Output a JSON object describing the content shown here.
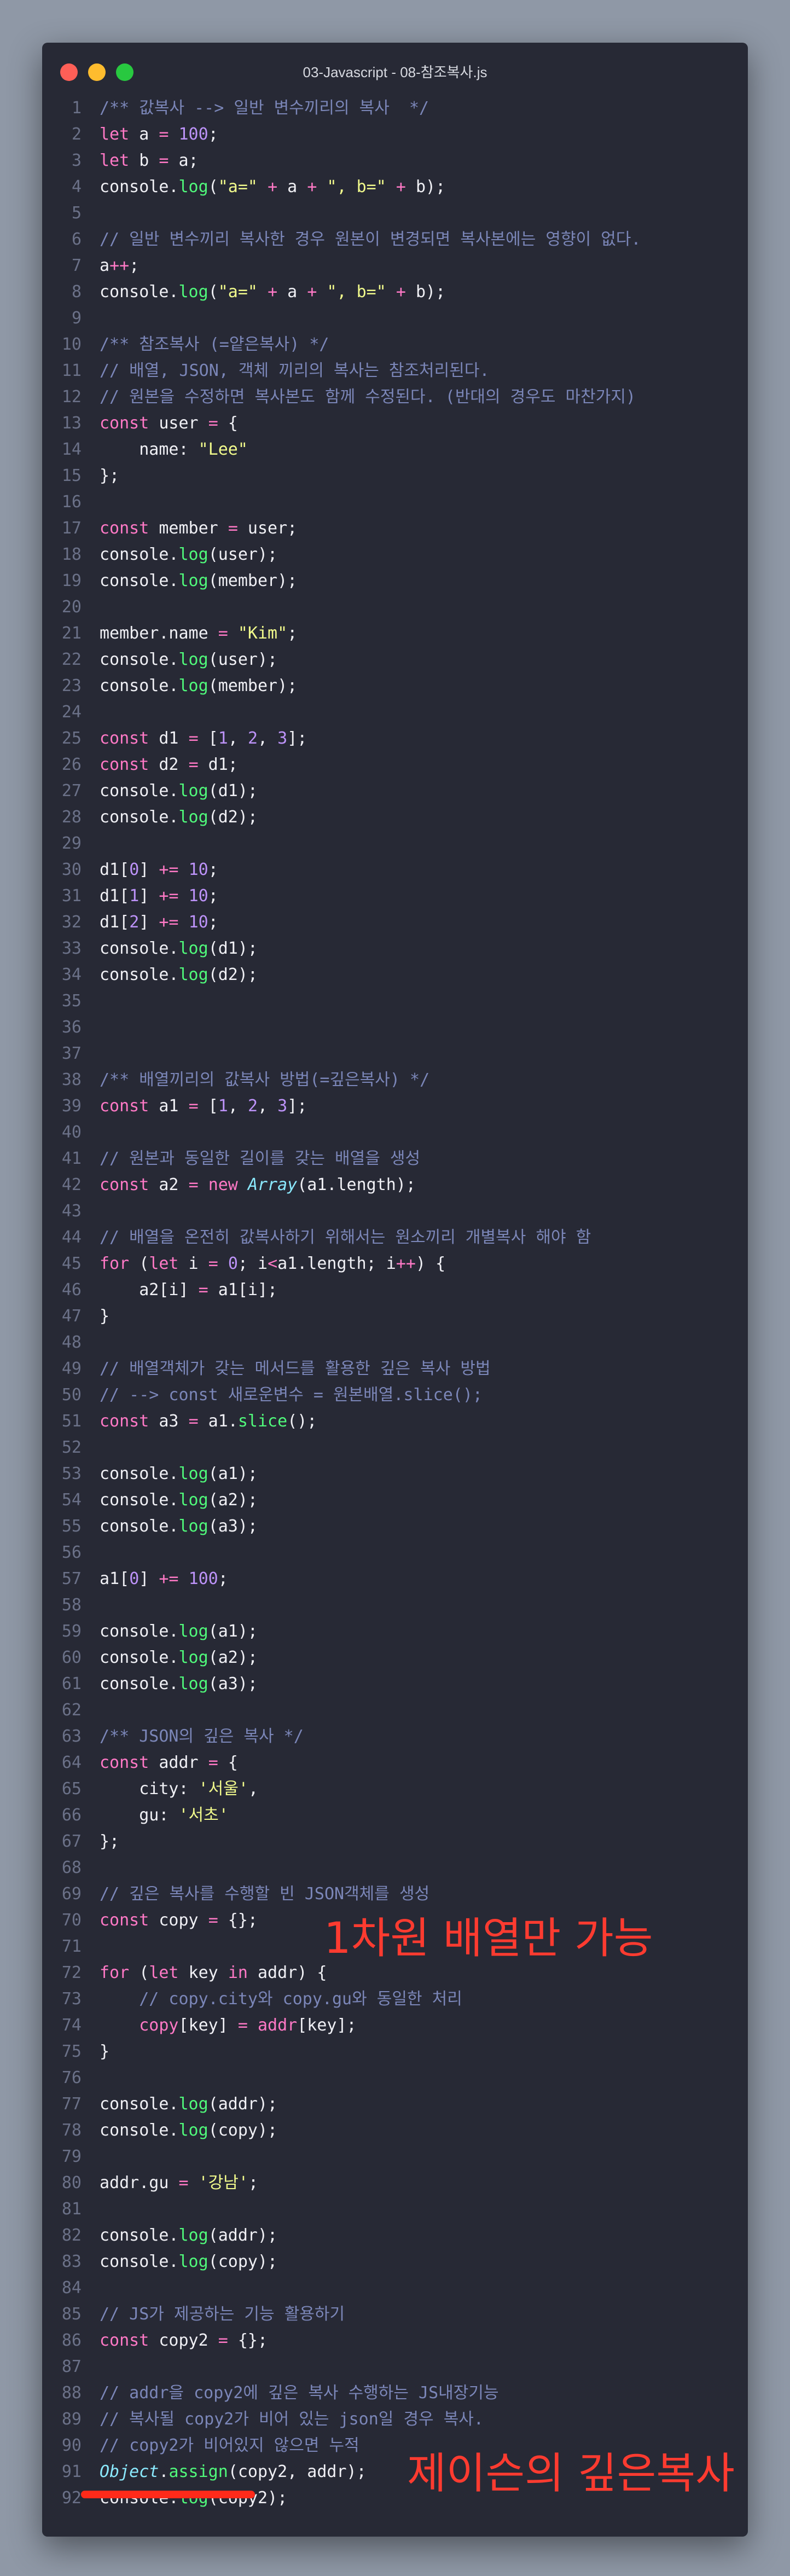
{
  "window": {
    "title": "03-Javascript - 08-참조복사.js"
  },
  "lines": [
    [
      [
        "cm",
        "/** 값복사 --> 일반 변수끼리의 복사  */"
      ]
    ],
    [
      [
        "kw",
        "let"
      ],
      [
        "pl",
        " a "
      ],
      [
        "op",
        "="
      ],
      [
        "pl",
        " "
      ],
      [
        "num",
        "100"
      ],
      [
        "pl",
        ";"
      ]
    ],
    [
      [
        "kw",
        "let"
      ],
      [
        "pl",
        " b "
      ],
      [
        "op",
        "="
      ],
      [
        "pl",
        " a;"
      ]
    ],
    [
      [
        "pl",
        "console."
      ],
      [
        "fn",
        "log"
      ],
      [
        "pl",
        "("
      ],
      [
        "str",
        "\"a=\""
      ],
      [
        "pl",
        " "
      ],
      [
        "op",
        "+"
      ],
      [
        "pl",
        " a "
      ],
      [
        "op",
        "+"
      ],
      [
        "pl",
        " "
      ],
      [
        "str",
        "\", b=\""
      ],
      [
        "pl",
        " "
      ],
      [
        "op",
        "+"
      ],
      [
        "pl",
        " b);"
      ]
    ],
    [],
    [
      [
        "cm",
        "// 일반 변수끼리 복사한 경우 원본이 변경되면 복사본에는 영향이 없다."
      ]
    ],
    [
      [
        "pl",
        "a"
      ],
      [
        "op",
        "++"
      ],
      [
        "pl",
        ";"
      ]
    ],
    [
      [
        "pl",
        "console."
      ],
      [
        "fn",
        "log"
      ],
      [
        "pl",
        "("
      ],
      [
        "str",
        "\"a=\""
      ],
      [
        "pl",
        " "
      ],
      [
        "op",
        "+"
      ],
      [
        "pl",
        " a "
      ],
      [
        "op",
        "+"
      ],
      [
        "pl",
        " "
      ],
      [
        "str",
        "\", b=\""
      ],
      [
        "pl",
        " "
      ],
      [
        "op",
        "+"
      ],
      [
        "pl",
        " b);"
      ]
    ],
    [],
    [
      [
        "cm",
        "/** 참조복사 (=얕은복사) */"
      ]
    ],
    [
      [
        "cm",
        "// 배열, JSON, 객체 끼리의 복사는 참조처리된다."
      ]
    ],
    [
      [
        "cm",
        "// 원본을 수정하면 복사본도 함께 수정된다. (반대의 경우도 마찬가지)"
      ]
    ],
    [
      [
        "kw",
        "const"
      ],
      [
        "pl",
        " user "
      ],
      [
        "op",
        "="
      ],
      [
        "pl",
        " {"
      ]
    ],
    [
      [
        "pl",
        "    name: "
      ],
      [
        "str",
        "\"Lee\""
      ]
    ],
    [
      [
        "pl",
        "};"
      ]
    ],
    [],
    [
      [
        "kw",
        "const"
      ],
      [
        "pl",
        " member "
      ],
      [
        "op",
        "="
      ],
      [
        "pl",
        " user;"
      ]
    ],
    [
      [
        "pl",
        "console."
      ],
      [
        "fn",
        "log"
      ],
      [
        "pl",
        "(user);"
      ]
    ],
    [
      [
        "pl",
        "console."
      ],
      [
        "fn",
        "log"
      ],
      [
        "pl",
        "(member);"
      ]
    ],
    [],
    [
      [
        "pl",
        "member.name "
      ],
      [
        "op",
        "="
      ],
      [
        "pl",
        " "
      ],
      [
        "str",
        "\"Kim\""
      ],
      [
        "pl",
        ";"
      ]
    ],
    [
      [
        "pl",
        "console."
      ],
      [
        "fn",
        "log"
      ],
      [
        "pl",
        "(user);"
      ]
    ],
    [
      [
        "pl",
        "console."
      ],
      [
        "fn",
        "log"
      ],
      [
        "pl",
        "(member);"
      ]
    ],
    [],
    [
      [
        "kw",
        "const"
      ],
      [
        "pl",
        " d1 "
      ],
      [
        "op",
        "="
      ],
      [
        "pl",
        " ["
      ],
      [
        "num",
        "1"
      ],
      [
        "pl",
        ", "
      ],
      [
        "num",
        "2"
      ],
      [
        "pl",
        ", "
      ],
      [
        "num",
        "3"
      ],
      [
        "pl",
        "];"
      ]
    ],
    [
      [
        "kw",
        "const"
      ],
      [
        "pl",
        " d2 "
      ],
      [
        "op",
        "="
      ],
      [
        "pl",
        " d1;"
      ]
    ],
    [
      [
        "pl",
        "console."
      ],
      [
        "fn",
        "log"
      ],
      [
        "pl",
        "(d1);"
      ]
    ],
    [
      [
        "pl",
        "console."
      ],
      [
        "fn",
        "log"
      ],
      [
        "pl",
        "(d2);"
      ]
    ],
    [],
    [
      [
        "pl",
        "d1["
      ],
      [
        "num",
        "0"
      ],
      [
        "pl",
        "] "
      ],
      [
        "op",
        "+="
      ],
      [
        "pl",
        " "
      ],
      [
        "num",
        "10"
      ],
      [
        "pl",
        ";"
      ]
    ],
    [
      [
        "pl",
        "d1["
      ],
      [
        "num",
        "1"
      ],
      [
        "pl",
        "] "
      ],
      [
        "op",
        "+="
      ],
      [
        "pl",
        " "
      ],
      [
        "num",
        "10"
      ],
      [
        "pl",
        ";"
      ]
    ],
    [
      [
        "pl",
        "d1["
      ],
      [
        "num",
        "2"
      ],
      [
        "pl",
        "] "
      ],
      [
        "op",
        "+="
      ],
      [
        "pl",
        " "
      ],
      [
        "num",
        "10"
      ],
      [
        "pl",
        ";"
      ]
    ],
    [
      [
        "pl",
        "console."
      ],
      [
        "fn",
        "log"
      ],
      [
        "pl",
        "(d1);"
      ]
    ],
    [
      [
        "pl",
        "console."
      ],
      [
        "fn",
        "log"
      ],
      [
        "pl",
        "(d2);"
      ]
    ],
    [],
    [],
    [],
    [
      [
        "cm",
        "/** 배열끼리의 값복사 방법(=깊은복사) */"
      ]
    ],
    [
      [
        "kw",
        "const"
      ],
      [
        "pl",
        " a1 "
      ],
      [
        "op",
        "="
      ],
      [
        "pl",
        " ["
      ],
      [
        "num",
        "1"
      ],
      [
        "pl",
        ", "
      ],
      [
        "num",
        "2"
      ],
      [
        "pl",
        ", "
      ],
      [
        "num",
        "3"
      ],
      [
        "pl",
        "];"
      ]
    ],
    [],
    [
      [
        "cm",
        "// 원본과 동일한 길이를 갖는 배열을 생성"
      ]
    ],
    [
      [
        "kw",
        "const"
      ],
      [
        "pl",
        " a2 "
      ],
      [
        "op",
        "="
      ],
      [
        "pl",
        " "
      ],
      [
        "kw",
        "new"
      ],
      [
        "pl",
        " "
      ],
      [
        "cls",
        "Array"
      ],
      [
        "pl",
        "(a1.length);"
      ]
    ],
    [],
    [
      [
        "cm",
        "// 배열을 온전히 값복사하기 위해서는 원소끼리 개별복사 해야 함"
      ]
    ],
    [
      [
        "kw",
        "for"
      ],
      [
        "pl",
        " ("
      ],
      [
        "kw",
        "let"
      ],
      [
        "pl",
        " i "
      ],
      [
        "op",
        "="
      ],
      [
        "pl",
        " "
      ],
      [
        "num",
        "0"
      ],
      [
        "pl",
        "; i"
      ],
      [
        "op",
        "<"
      ],
      [
        "pl",
        "a1.length; i"
      ],
      [
        "op",
        "++"
      ],
      [
        "pl",
        ") {"
      ]
    ],
    [
      [
        "pl",
        "    a2[i] "
      ],
      [
        "op",
        "="
      ],
      [
        "pl",
        " a1[i];"
      ]
    ],
    [
      [
        "pl",
        "}"
      ]
    ],
    [],
    [
      [
        "cm",
        "// 배열객체가 갖는 메서드를 활용한 깊은 복사 방법"
      ]
    ],
    [
      [
        "cm",
        "// --> const 새로운변수 = 원본배열.slice();"
      ]
    ],
    [
      [
        "kw",
        "const"
      ],
      [
        "pl",
        " a3 "
      ],
      [
        "op",
        "="
      ],
      [
        "pl",
        " a1."
      ],
      [
        "fn",
        "slice"
      ],
      [
        "pl",
        "();"
      ]
    ],
    [],
    [
      [
        "pl",
        "console."
      ],
      [
        "fn",
        "log"
      ],
      [
        "pl",
        "(a1);"
      ]
    ],
    [
      [
        "pl",
        "console."
      ],
      [
        "fn",
        "log"
      ],
      [
        "pl",
        "(a2);"
      ]
    ],
    [
      [
        "pl",
        "console."
      ],
      [
        "fn",
        "log"
      ],
      [
        "pl",
        "(a3);"
      ]
    ],
    [],
    [
      [
        "pl",
        "a1["
      ],
      [
        "num",
        "0"
      ],
      [
        "pl",
        "] "
      ],
      [
        "op",
        "+="
      ],
      [
        "pl",
        " "
      ],
      [
        "num",
        "100"
      ],
      [
        "pl",
        ";"
      ]
    ],
    [],
    [
      [
        "pl",
        "console."
      ],
      [
        "fn",
        "log"
      ],
      [
        "pl",
        "(a1);"
      ]
    ],
    [
      [
        "pl",
        "console."
      ],
      [
        "fn",
        "log"
      ],
      [
        "pl",
        "(a2);"
      ]
    ],
    [
      [
        "pl",
        "console."
      ],
      [
        "fn",
        "log"
      ],
      [
        "pl",
        "(a3);"
      ]
    ],
    [],
    [
      [
        "cm",
        "/** JSON의 깊은 복사 */"
      ]
    ],
    [
      [
        "kw",
        "const"
      ],
      [
        "pl",
        " addr "
      ],
      [
        "op",
        "="
      ],
      [
        "pl",
        " {"
      ]
    ],
    [
      [
        "pl",
        "    city: "
      ],
      [
        "str",
        "'서울'"
      ],
      [
        "pl",
        ","
      ]
    ],
    [
      [
        "pl",
        "    gu: "
      ],
      [
        "str",
        "'서초'"
      ]
    ],
    [
      [
        "pl",
        "};"
      ]
    ],
    [],
    [
      [
        "cm",
        "// 깊은 복사를 수행할 빈 JSON객체를 생성"
      ]
    ],
    [
      [
        "kw",
        "const"
      ],
      [
        "pl",
        " copy "
      ],
      [
        "op",
        "="
      ],
      [
        "pl",
        " {};"
      ]
    ],
    [],
    [
      [
        "kw",
        "for"
      ],
      [
        "pl",
        " ("
      ],
      [
        "kw",
        "let"
      ],
      [
        "pl",
        " key "
      ],
      [
        "kw",
        "in"
      ],
      [
        "pl",
        " addr) {"
      ]
    ],
    [
      [
        "pl",
        "    "
      ],
      [
        "cm",
        "// copy.city와 copy.gu와 동일한 처리"
      ]
    ],
    [
      [
        "pl",
        "    "
      ],
      [
        "prop",
        "copy"
      ],
      [
        "pl",
        "[key] "
      ],
      [
        "op",
        "="
      ],
      [
        "pl",
        " "
      ],
      [
        "prop",
        "addr"
      ],
      [
        "pl",
        "[key];"
      ]
    ],
    [
      [
        "pl",
        "}"
      ]
    ],
    [],
    [
      [
        "pl",
        "console."
      ],
      [
        "fn",
        "log"
      ],
      [
        "pl",
        "(addr);"
      ]
    ],
    [
      [
        "pl",
        "console."
      ],
      [
        "fn",
        "log"
      ],
      [
        "pl",
        "(copy);"
      ]
    ],
    [],
    [
      [
        "pl",
        "addr.gu "
      ],
      [
        "op",
        "="
      ],
      [
        "pl",
        " "
      ],
      [
        "str",
        "'강남'"
      ],
      [
        "pl",
        ";"
      ]
    ],
    [],
    [
      [
        "pl",
        "console."
      ],
      [
        "fn",
        "log"
      ],
      [
        "pl",
        "(addr);"
      ]
    ],
    [
      [
        "pl",
        "console."
      ],
      [
        "fn",
        "log"
      ],
      [
        "pl",
        "(copy);"
      ]
    ],
    [],
    [
      [
        "cm",
        "// JS가 제공하는 기능 활용하기"
      ]
    ],
    [
      [
        "kw",
        "const"
      ],
      [
        "pl",
        " copy2 "
      ],
      [
        "op",
        "="
      ],
      [
        "pl",
        " {};"
      ]
    ],
    [],
    [
      [
        "cm",
        "// addr을 copy2에 깊은 복사 수행하는 JS내장기능"
      ]
    ],
    [
      [
        "cm",
        "// 복사될 copy2가 비어 있는 json일 경우 복사."
      ]
    ],
    [
      [
        "cm",
        "// copy2가 비어있지 않으면 누적"
      ]
    ],
    [
      [
        "cls",
        "Object"
      ],
      [
        "pl",
        "."
      ],
      [
        "fn",
        "assign"
      ],
      [
        "pl",
        "(copy2, addr);"
      ]
    ],
    [
      [
        "pl",
        "console."
      ],
      [
        "fn",
        "log"
      ],
      [
        "pl",
        "(copy2);"
      ]
    ]
  ],
  "annotations": {
    "one_dim_only": "1차원 배열만 가능",
    "json_deep_copy": "제이슨의 깊은복사"
  }
}
